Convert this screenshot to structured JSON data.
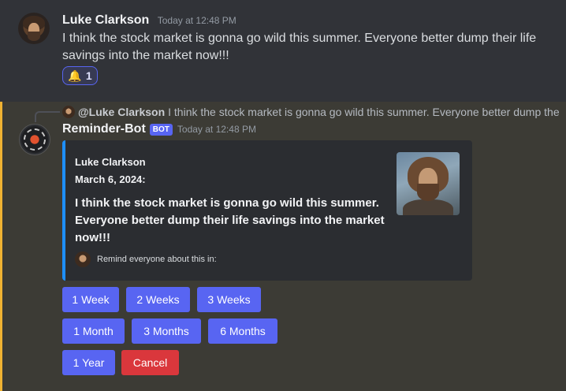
{
  "message1": {
    "username": "Luke Clarkson",
    "timestamp": "Today at 12:48 PM",
    "content": "I think the stock market is gonna go wild this summer. Everyone better dump their life savings into the market now!!!",
    "reaction": {
      "icon": "bell-icon",
      "emoji": "🔔",
      "count": "1"
    }
  },
  "message2": {
    "reply": {
      "mention": "@Luke Clarkson",
      "text": "I think the stock market is gonna go wild this summer. Everyone better dump the"
    },
    "username": "Reminder-Bot",
    "bot_tag": "BOT",
    "timestamp": "Today at 12:48 PM",
    "embed": {
      "author": "Luke Clarkson",
      "date": "March 6, 2024:",
      "body": "I think the stock market is gonna go wild this summer. Everyone better dump their life savings into the market now!!!",
      "footer": "Remind everyone about this in:",
      "accent_color": "#1e8fff"
    },
    "buttons": {
      "week1": "1 Week",
      "weeks2": "2 Weeks",
      "weeks3": "3 Weeks",
      "month1": "1 Month",
      "months3": "3 Months",
      "months6": "6 Months",
      "year1": "1 Year",
      "cancel": "Cancel"
    }
  },
  "colors": {
    "background": "#313338",
    "mention_highlight": "#3c3b35",
    "mention_bar": "#f0b232",
    "blurple": "#5865f2",
    "danger": "#da373c"
  }
}
